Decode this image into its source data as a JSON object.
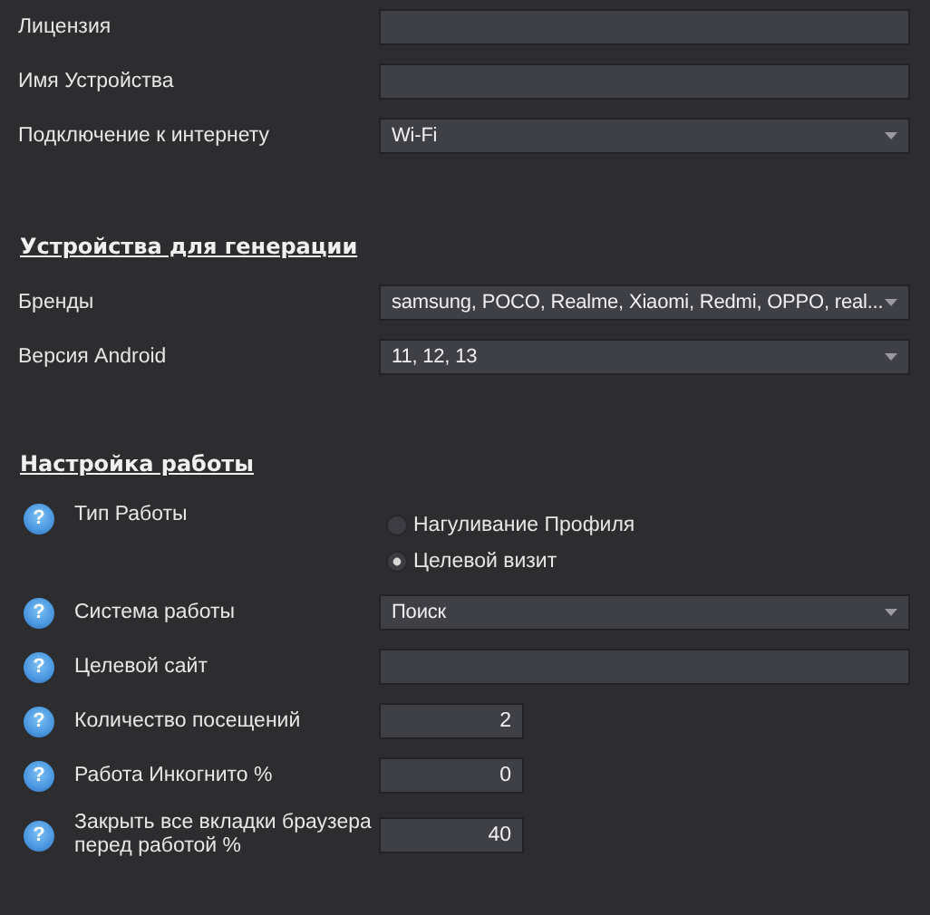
{
  "sections": [
    {
      "rows": [
        {
          "kind": "text",
          "label": "Лицензия"
        },
        {
          "kind": "text",
          "label": "Имя Устройства"
        },
        {
          "kind": "select",
          "label": "Подключение к интернету",
          "value": "Wi-Fi"
        }
      ]
    },
    {
      "heading": "Устройства для генерации",
      "rows": [
        {
          "kind": "select",
          "label": "Бренды",
          "value": "samsung, POCO, Realme, Xiaomi, Redmi, OPPO, real..."
        },
        {
          "kind": "select",
          "label": "Версия Android",
          "value": "11, 12, 13"
        }
      ]
    },
    {
      "heading": "Настройка работы",
      "rows": [
        {
          "kind": "radio",
          "label": "Тип Работы",
          "help": "?",
          "options": [
            {
              "label": "Нагуливание Профиля",
              "selected": false
            },
            {
              "label": "Целевой визит",
              "selected": true
            }
          ]
        },
        {
          "kind": "select",
          "label": "Система работы",
          "help": "?",
          "value": "Поиск"
        },
        {
          "kind": "text",
          "label": "Целевой сайт",
          "help": "?"
        },
        {
          "kind": "number",
          "label": "Количество посещений",
          "help": "?",
          "value": "2"
        },
        {
          "kind": "number",
          "label": "Работа Инкогнито %",
          "help": "?",
          "value": "0"
        },
        {
          "kind": "number",
          "label": "Закрыть все вкладки браузера перед работой %",
          "help": "?",
          "value": "40"
        }
      ]
    }
  ]
}
